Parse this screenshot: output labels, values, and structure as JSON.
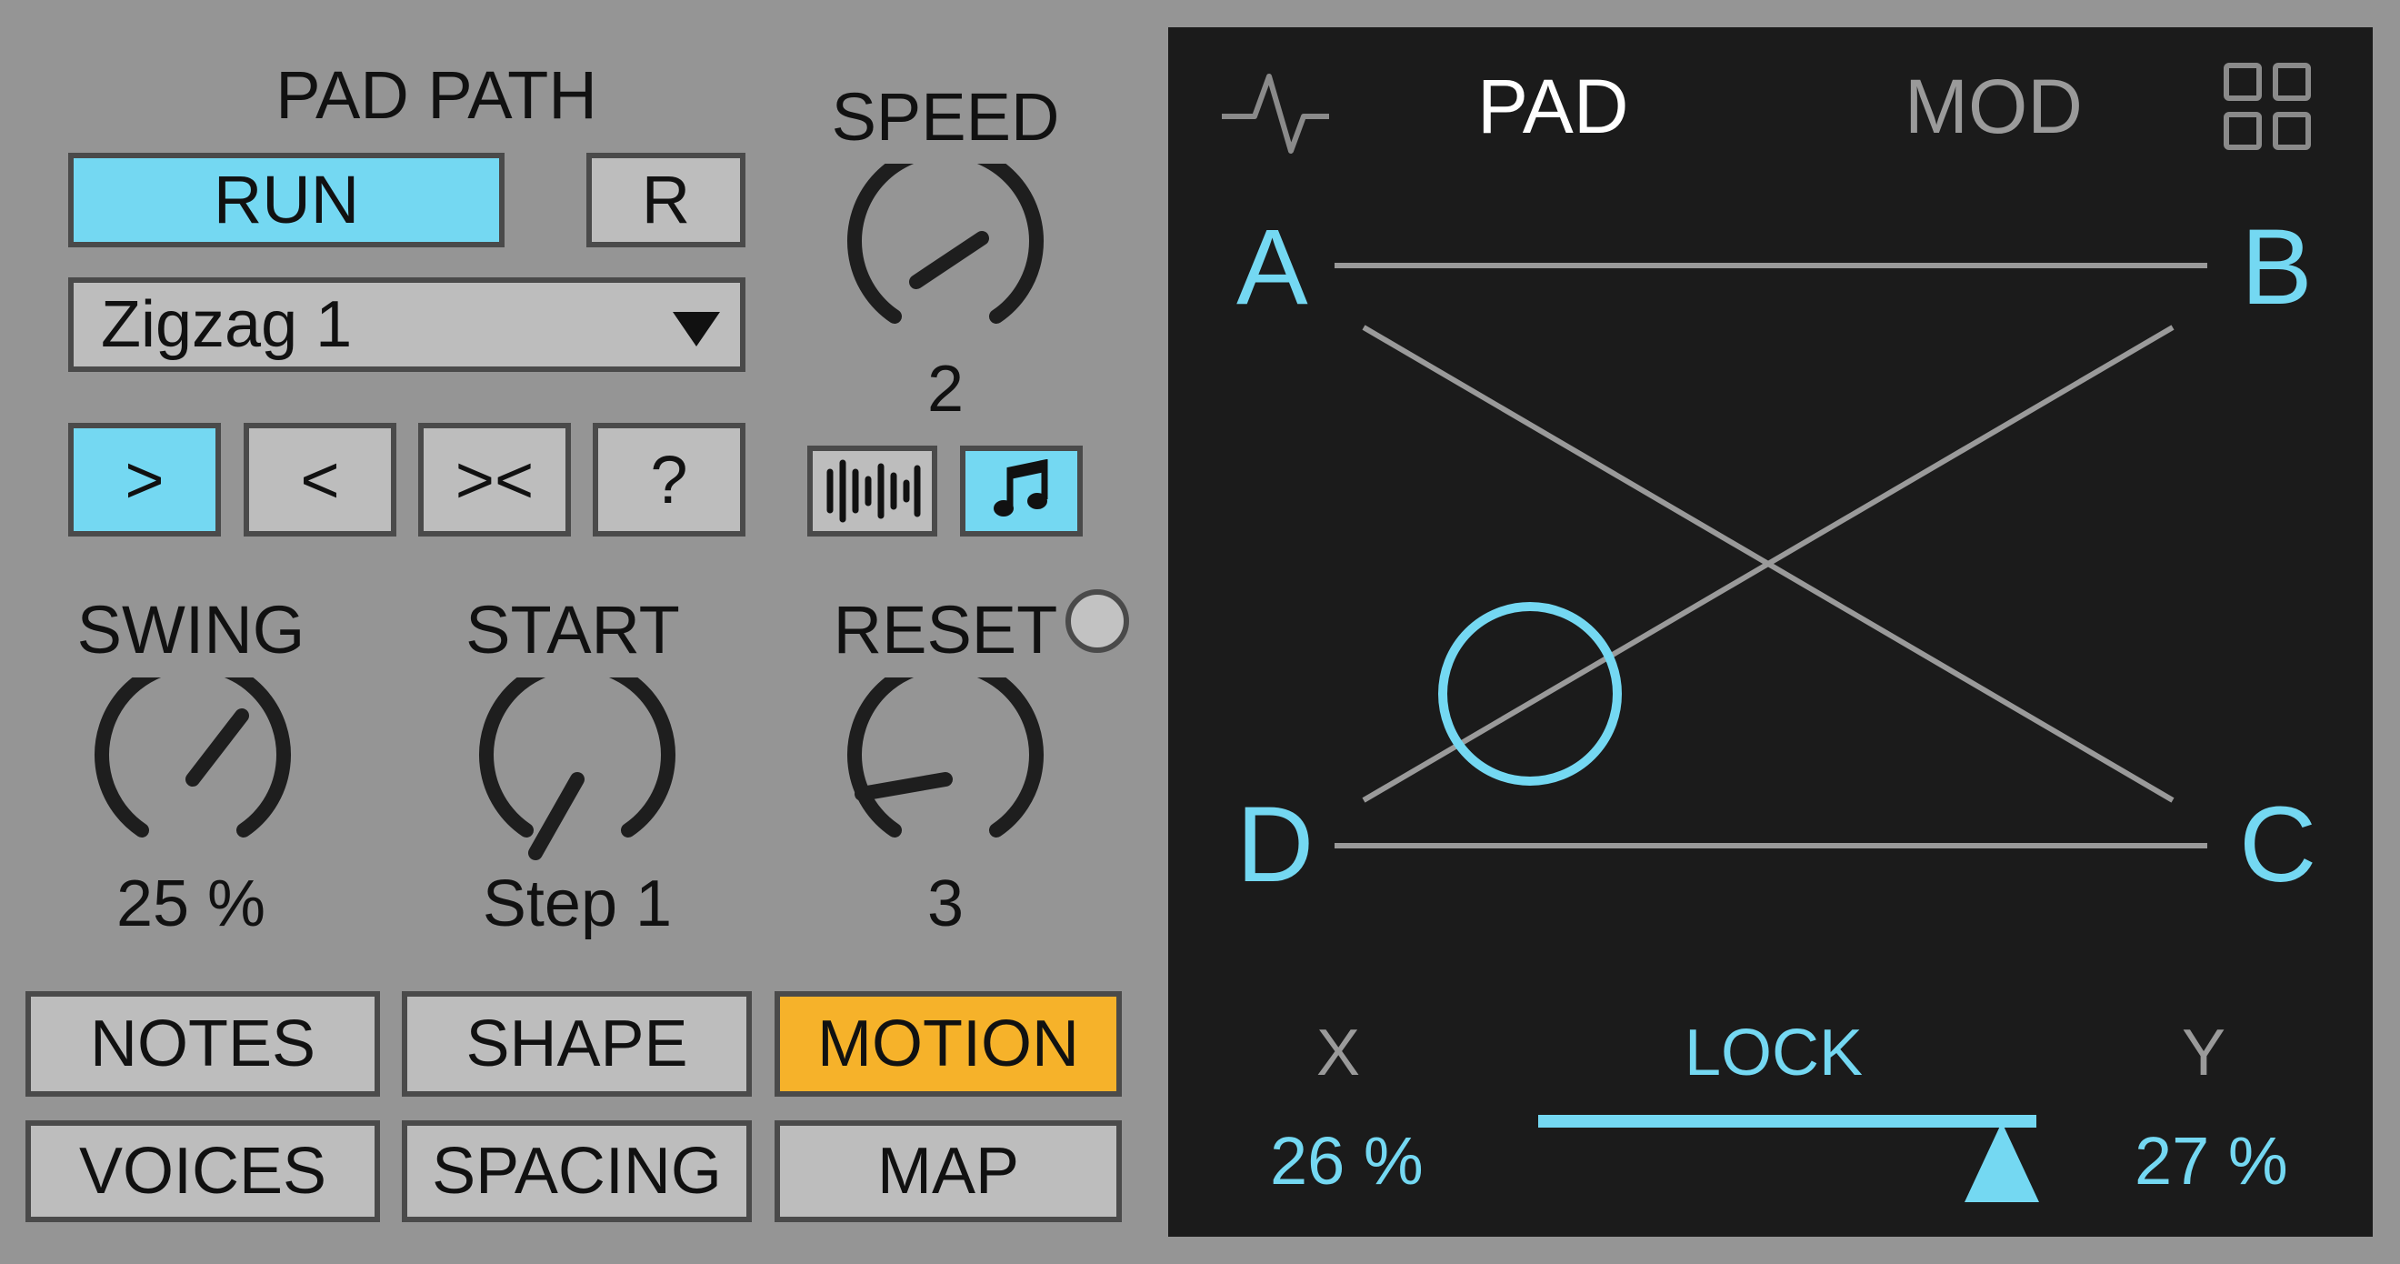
{
  "path": {
    "title": "PAD PATH",
    "run_label": "RUN",
    "reset_button_label": "R",
    "preset": "Zigzag 1",
    "dirs": [
      ">",
      "<",
      "><",
      "?"
    ]
  },
  "speed": {
    "label": "SPEED",
    "value": "2"
  },
  "knobs": {
    "swing": {
      "label": "SWING",
      "value": "25 %"
    },
    "start": {
      "label": "START",
      "value": "Step 1"
    },
    "reset": {
      "label": "RESET",
      "value": "3"
    }
  },
  "tabs": {
    "row1": [
      "NOTES",
      "SHAPE",
      "MOTION"
    ],
    "row2": [
      "VOICES",
      "SPACING",
      "MAP"
    ]
  },
  "pad": {
    "tab_pad": "PAD",
    "tab_mod": "MOD",
    "corners": {
      "a": "A",
      "b": "B",
      "c": "C",
      "d": "D"
    },
    "x_label": "X",
    "lock_label": "LOCK",
    "y_label": "Y",
    "x_value": "26 %",
    "y_value": "27 %"
  },
  "colors": {
    "accent": "#74d8f2",
    "active_tab": "#f6b22a",
    "panel": "#1b1b1b",
    "background": "#959595"
  },
  "icons": [
    "waveform-icon",
    "grid-icon",
    "bars-icon",
    "music-note-icon",
    "dropdown-arrow-icon"
  ]
}
